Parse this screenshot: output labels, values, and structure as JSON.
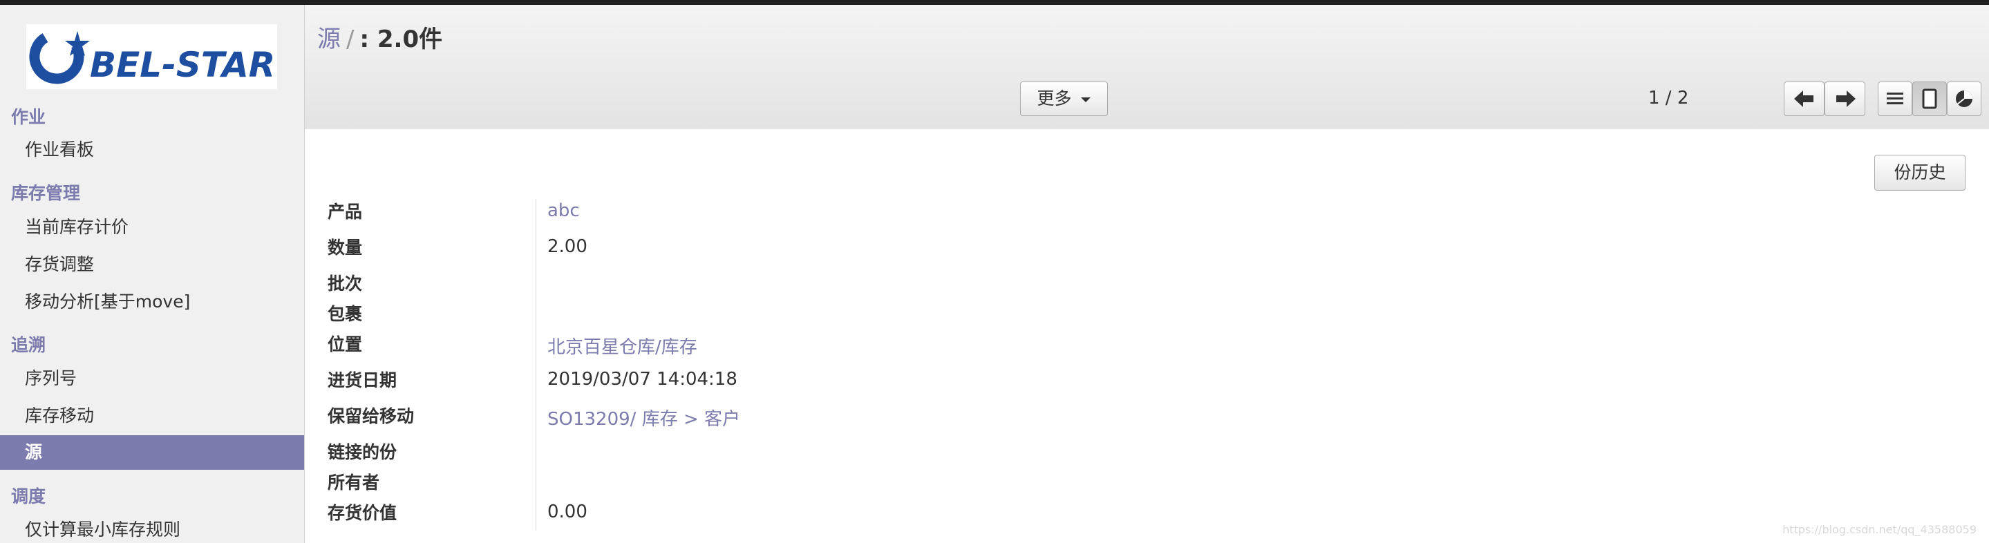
{
  "sidebar": {
    "logo_text": "BEL-STAR",
    "sections": [
      {
        "title": "作业",
        "items": [
          {
            "label": "作业看板",
            "active": false
          }
        ]
      },
      {
        "title": "库存管理",
        "items": [
          {
            "label": "当前库存计价",
            "active": false
          },
          {
            "label": "存货调整",
            "active": false
          },
          {
            "label": "移动分析[基于move]",
            "active": false
          }
        ]
      },
      {
        "title": "追溯",
        "items": [
          {
            "label": "序列号",
            "active": false
          },
          {
            "label": "库存移动",
            "active": false
          },
          {
            "label": "源",
            "active": true
          }
        ]
      },
      {
        "title": "调度",
        "items": [
          {
            "label": "仅计算最小库存规则",
            "active": false
          }
        ]
      }
    ]
  },
  "breadcrumb": {
    "parent": "源",
    "separator": "/",
    "current": ": 2.0件"
  },
  "toolbar": {
    "more_label": "更多",
    "pager": "1 / 2"
  },
  "form": {
    "history_button": "份历史",
    "fields": [
      {
        "label": "产品",
        "value": "abc",
        "link": true
      },
      {
        "label": "数量",
        "value": "2.00",
        "link": false
      },
      {
        "label": "批次",
        "value": "",
        "link": false
      },
      {
        "label": "包裹",
        "value": "",
        "link": false
      },
      {
        "label": "位置",
        "value": "北京百星仓库/库存",
        "link": true
      },
      {
        "label": "进货日期",
        "value": "2019/03/07 14:04:18",
        "link": false
      },
      {
        "label": "保留给移动",
        "value": "SO13209/ 库存 > 客户",
        "link": true
      },
      {
        "label": "链接的份",
        "value": "",
        "link": false
      },
      {
        "label": "所有者",
        "value": "",
        "link": false
      },
      {
        "label": "存货价值",
        "value": "0.00",
        "link": false
      }
    ]
  },
  "watermark": "https://blog.csdn.net/qq_43588059",
  "colors": {
    "accent": "#7c7bad",
    "logo_blue": "#1e4ea0"
  }
}
